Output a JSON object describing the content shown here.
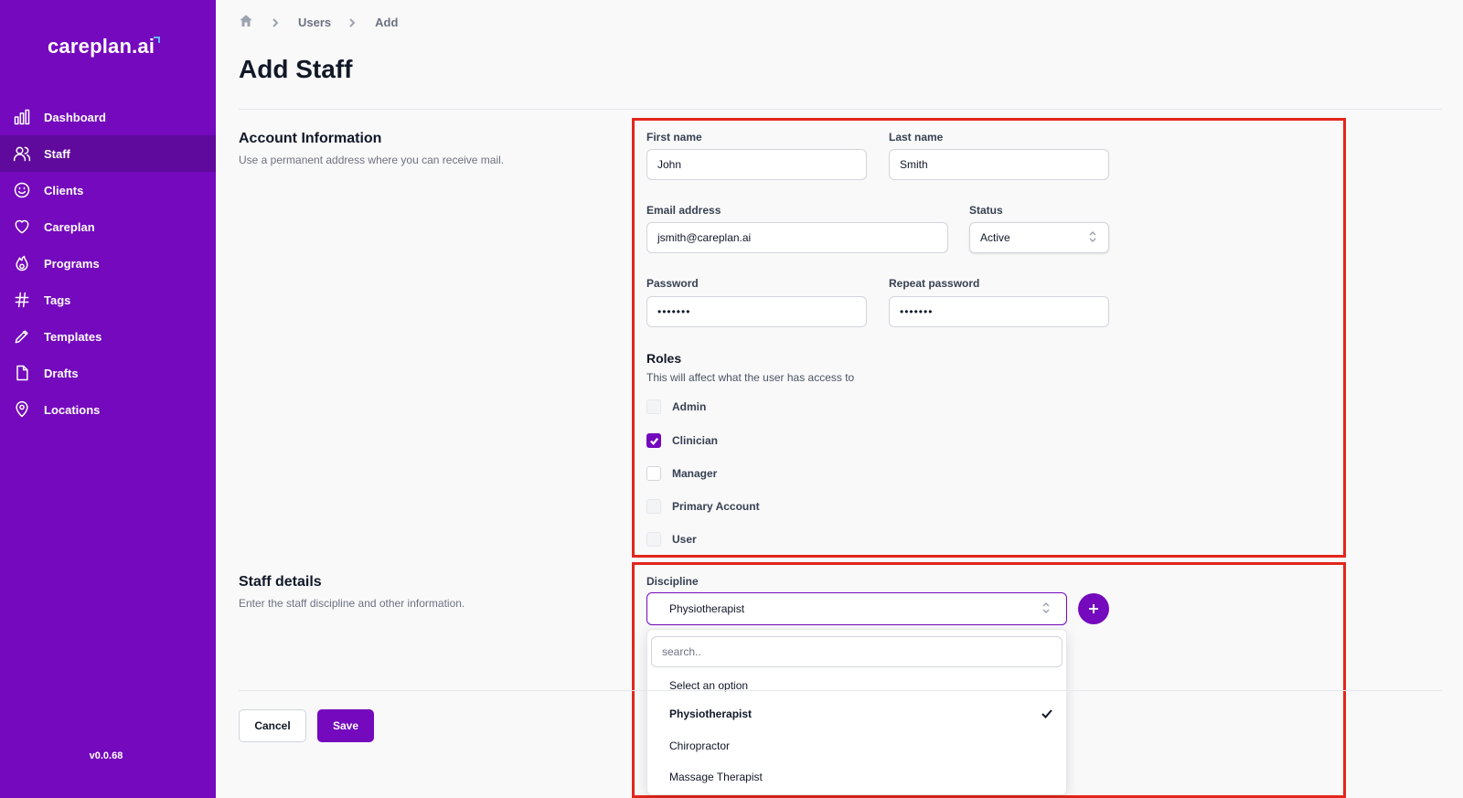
{
  "sidebar": {
    "logo": "careplan.ai",
    "items": [
      {
        "label": "Dashboard",
        "icon": "chart-bar-icon"
      },
      {
        "label": "Staff",
        "icon": "users-icon"
      },
      {
        "label": "Clients",
        "icon": "smiley-icon"
      },
      {
        "label": "Careplan",
        "icon": "heart-icon"
      },
      {
        "label": "Programs",
        "icon": "fire-icon"
      },
      {
        "label": "Tags",
        "icon": "hashtag-icon"
      },
      {
        "label": "Templates",
        "icon": "pencil-icon"
      },
      {
        "label": "Drafts",
        "icon": "document-icon"
      },
      {
        "label": "Locations",
        "icon": "location-pin-icon"
      }
    ],
    "active": "Staff",
    "version": "v0.0.68"
  },
  "breadcrumb": {
    "items": [
      "Users",
      "Add"
    ]
  },
  "page": {
    "title": "Add Staff"
  },
  "account": {
    "title": "Account Information",
    "subtitle": "Use a permanent address where you can receive mail.",
    "first_name_label": "First name",
    "first_name": "John",
    "last_name_label": "Last name",
    "last_name": "Smith",
    "email_label": "Email address",
    "email": "jsmith@careplan.ai",
    "status_label": "Status",
    "status": "Active",
    "password_label": "Password",
    "password": "•••••••",
    "repeat_password_label": "Repeat password",
    "repeat_password": "•••••••"
  },
  "roles": {
    "title": "Roles",
    "subtitle": "This will affect what the user has access to",
    "items": [
      {
        "label": "Admin",
        "checked": false,
        "disabled": true
      },
      {
        "label": "Clinician",
        "checked": true,
        "disabled": false
      },
      {
        "label": "Manager",
        "checked": false,
        "disabled": false
      },
      {
        "label": "Primary Account",
        "checked": false,
        "disabled": true
      },
      {
        "label": "User",
        "checked": false,
        "disabled": true
      }
    ]
  },
  "staff_details": {
    "title": "Staff details",
    "subtitle": "Enter the staff discipline and other information.",
    "discipline_label": "Discipline",
    "discipline": "Physiotherapist",
    "search_placeholder": "search..",
    "options": [
      "Select an option",
      "Physiotherapist",
      "Chiropractor",
      "Massage Therapist"
    ],
    "selected_option": "Physiotherapist"
  },
  "actions": {
    "cancel": "Cancel",
    "save": "Save"
  },
  "colors": {
    "brand": "#7409bd",
    "brand_dark": "#5f0a9c",
    "highlight": "#e3261b"
  }
}
